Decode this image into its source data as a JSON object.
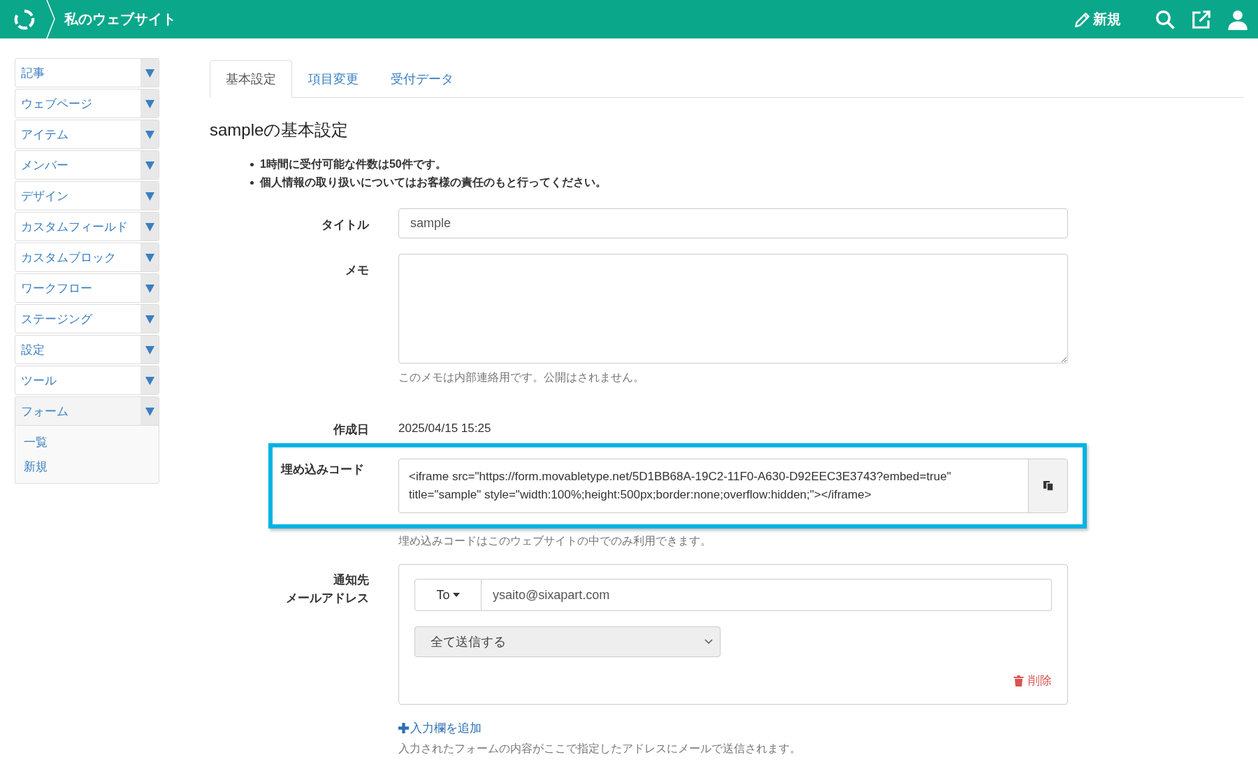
{
  "header": {
    "site_title": "私のウェブサイト",
    "new_label": "新規"
  },
  "sidebar": {
    "items": [
      {
        "label": "記事",
        "expanded": false
      },
      {
        "label": "ウェブページ",
        "expanded": false
      },
      {
        "label": "アイテム",
        "expanded": false
      },
      {
        "label": "メンバー",
        "expanded": false
      },
      {
        "label": "デザイン",
        "expanded": false
      },
      {
        "label": "カスタムフィールド",
        "expanded": false
      },
      {
        "label": "カスタムブロック",
        "expanded": false
      },
      {
        "label": "ワークフロー",
        "expanded": false
      },
      {
        "label": "ステージング",
        "expanded": false
      },
      {
        "label": "設定",
        "expanded": false
      },
      {
        "label": "ツール",
        "expanded": false
      },
      {
        "label": "フォーム",
        "expanded": true,
        "children": [
          {
            "label": "一覧"
          },
          {
            "label": "新規"
          }
        ]
      }
    ]
  },
  "tabs": [
    {
      "label": "基本設定",
      "selected": true
    },
    {
      "label": "項目変更",
      "selected": false
    },
    {
      "label": "受付データ",
      "selected": false
    }
  ],
  "heading": "sampleの基本設定",
  "notes": [
    "1時間に受付可能な件数は50件です。",
    "個人情報の取り扱いについてはお客様の責任のもと行ってください。"
  ],
  "title_field": {
    "label": "タイトル",
    "value": "sample"
  },
  "memo_field": {
    "label": "メモ",
    "hint": "このメモは内部連絡用です。公開はされません。"
  },
  "created": {
    "label": "作成日",
    "value": "2025/04/15 15:25"
  },
  "embed": {
    "label": "埋め込みコード",
    "highlighted": true,
    "value": "<iframe src=\"https://form.movabletype.net/5D1BB68A-19C2-11F0-A630-D92EEC3E3743?embed=true\" title=\"sample\" style=\"width:100%;height:500px;border:none;overflow:hidden;\"></iframe>",
    "hint": "埋め込みコードはこのウェブサイトの中でのみ利用できます。"
  },
  "notify": {
    "label_lines": [
      "通知先",
      "メールアドレス"
    ],
    "recipients": [
      {
        "type": "To",
        "email": "ysaito@sixapart.com",
        "mode": "全て送信する",
        "delete_label": "削除"
      }
    ],
    "add_label": "入力欄を追加",
    "hint": "入力されたフォームの内容がここで指定したアドレスにメールで送信されます。"
  }
}
